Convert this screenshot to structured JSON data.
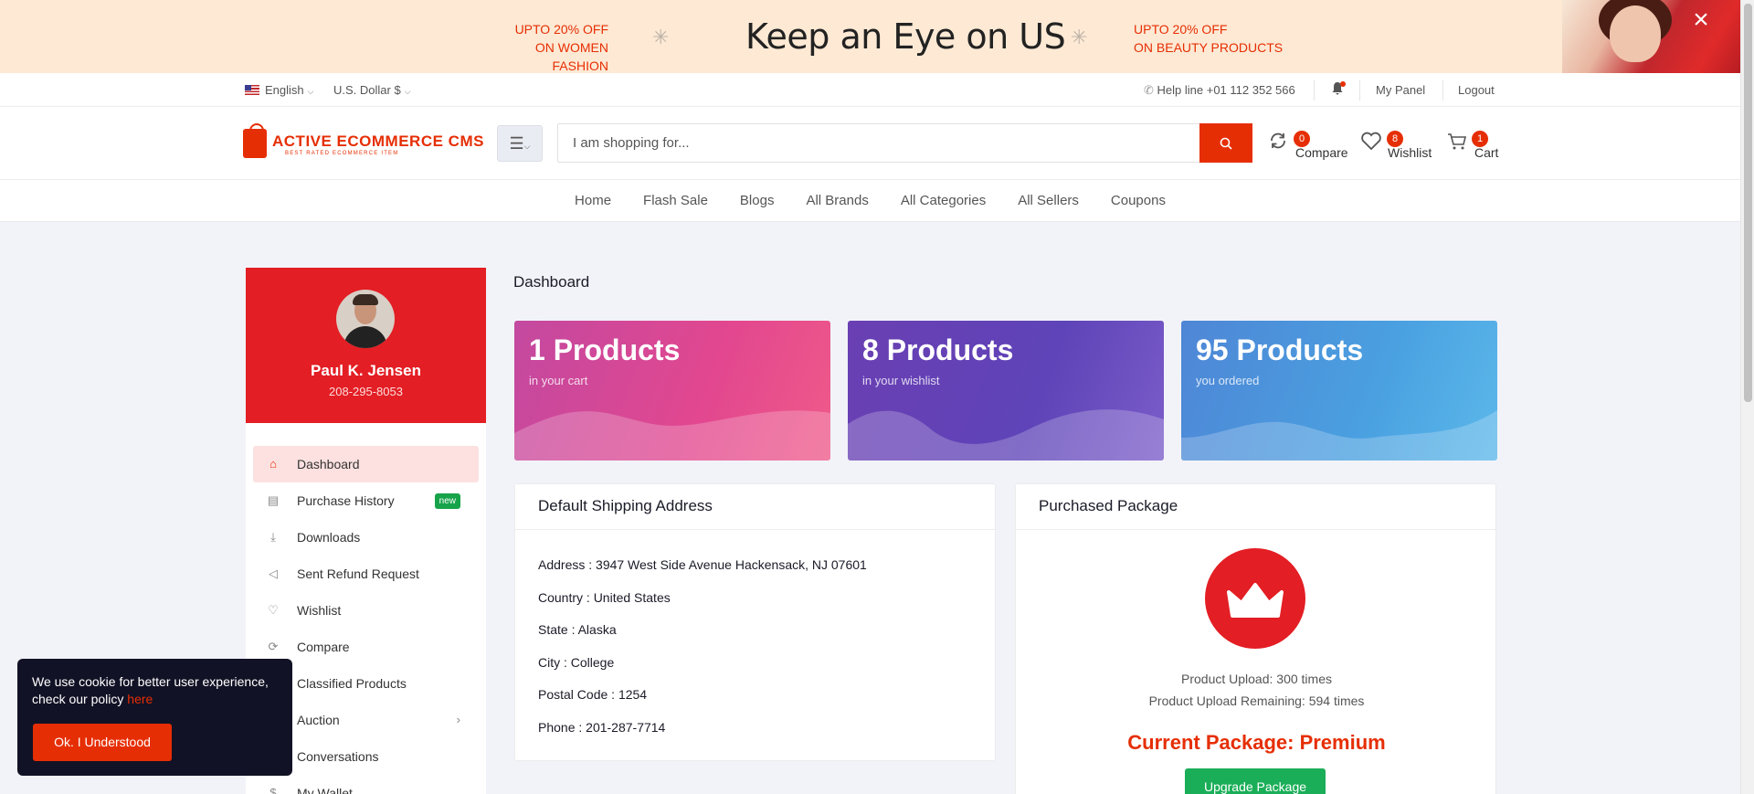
{
  "banner": {
    "promo_left_line1": "UPTO 20% OFF",
    "promo_left_line2": "ON WOMEN FASHION",
    "tagline": "Keep an Eye on US",
    "promo_right_line1": "UPTO 20% OFF",
    "promo_right_line2": "ON BEAUTY PRODUCTS",
    "close_icon": "×"
  },
  "topbar": {
    "language": "English",
    "currency": "U.S. Dollar $",
    "helpline": "Help line +01 112 352 566",
    "my_panel": "My Panel",
    "logout": "Logout"
  },
  "header": {
    "logo_name": "ACTIVE ECOMMERCE CMS",
    "logo_sub": "BEST RATED ECOMMERCE ITEM",
    "search_placeholder": "I am shopping for...",
    "compare_label": "Compare",
    "compare_count": "0",
    "wishlist_label": "Wishlist",
    "wishlist_count": "8",
    "cart_label": "Cart",
    "cart_count": "1"
  },
  "nav": {
    "items": [
      "Home",
      "Flash Sale",
      "Blogs",
      "All Brands",
      "All Categories",
      "All Sellers",
      "Coupons"
    ]
  },
  "profile": {
    "name": "Paul K. Jensen",
    "phone": "208-295-8053"
  },
  "sidebar": {
    "items": [
      {
        "label": "Dashboard",
        "icon": "home-icon"
      },
      {
        "label": "Purchase History",
        "icon": "file-icon",
        "badge": "new"
      },
      {
        "label": "Downloads",
        "icon": "download-icon"
      },
      {
        "label": "Sent Refund Request",
        "icon": "refund-icon"
      },
      {
        "label": "Wishlist",
        "icon": "heart-icon"
      },
      {
        "label": "Compare",
        "icon": "refresh-icon"
      },
      {
        "label": "Classified Products",
        "icon": "diamond-icon"
      },
      {
        "label": "Auction",
        "icon": "gavel-icon"
      },
      {
        "label": "Conversations",
        "icon": "chat-icon"
      },
      {
        "label": "My Wallet",
        "icon": "dollar-icon"
      }
    ]
  },
  "dashboard": {
    "title": "Dashboard",
    "cards": [
      {
        "value": "1 Products",
        "sub": "in your cart"
      },
      {
        "value": "8 Products",
        "sub": "in your wishlist"
      },
      {
        "value": "95 Products",
        "sub": "you ordered"
      }
    ]
  },
  "shipping": {
    "title": "Default Shipping Address",
    "address": "Address : 3947 West Side Avenue Hackensack, NJ 07601",
    "country": "Country : United States",
    "state": "State : Alaska",
    "city": "City : College",
    "postal": "Postal Code : 1254",
    "phone": "Phone : 201-287-7714"
  },
  "package": {
    "title": "Purchased Package",
    "upload": "Product Upload: 300 times",
    "remaining": "Product Upload Remaining: 594 times",
    "current": "Current Package: Premium",
    "upgrade_label": "Upgrade Package"
  },
  "cookie": {
    "message": "We use cookie for better user experience, check our policy ",
    "link": "here",
    "button": "Ok. I Understood"
  },
  "colors": {
    "accent": "#e62e04",
    "profile_bg": "#e31e24",
    "success": "#1bae58",
    "cookie_bg": "#121226"
  }
}
